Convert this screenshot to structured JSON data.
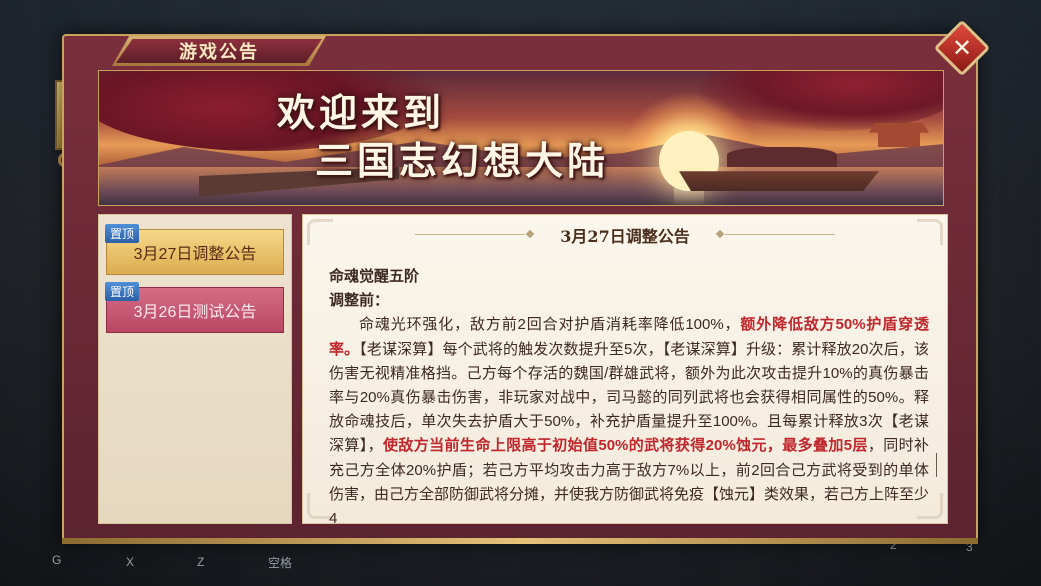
{
  "window": {
    "title": "游戏公告",
    "close_icon": "close-icon"
  },
  "banner": {
    "line1": "欢迎来到",
    "line2": "三国志幻想大陆"
  },
  "tabs": [
    {
      "pin_label": "置顶",
      "label": "3月27日调整公告",
      "active": true
    },
    {
      "pin_label": "置顶",
      "label": "3月26日测试公告",
      "active": false
    }
  ],
  "content": {
    "title": "3月27日调整公告",
    "heading": "命魂觉醒五阶",
    "subheading": "调整前：",
    "paragraph_segments": [
      {
        "text": "命魂光环强化，敌方前2回合对护盾消耗率降低100%，",
        "highlight": false
      },
      {
        "text": "额外降低敌方50%护盾穿透率。",
        "highlight": true
      },
      {
        "text": "【老谋深算】每个武将的触发次数提升至5次，【老谋深算】升级：累计释放20次后，该伤害无视精准格挡。己方每个存活的魏国/群雄武将，额外为此次攻击提升10%的真伤暴击率与20%真伤暴击伤害，非玩家对战中，司马懿的同列武将也会获得相同属性的50%。释放命魂技后，单次失去护盾大于50%，补充护盾量提升至100%。且每累计释放3次【老谋深算】，",
        "highlight": false
      },
      {
        "text": "使敌方当前生命上限高于初始值50%的武将获得20%蚀元，最多叠加5层",
        "highlight": true
      },
      {
        "text": "，同时补充己方全体20%护盾；若己方平均攻击力高于敌方7%以上，前2回合己方武将受到的单体伤害，由己方全部防御武将分摊，并使我方防御武将免疫【蚀元】类效果，若己方上阵至少4",
        "highlight": false
      }
    ]
  },
  "hotkeys": [
    "G",
    "X",
    "Z",
    "空格",
    "2",
    "3"
  ],
  "colors": {
    "frame": "#7a2f3c",
    "gold": "#c9a35d",
    "paper": "#f4ecdf",
    "highlight": "#c0262c",
    "active_tab": "#dcac4f",
    "inactive_tab": "#b94764",
    "pin": "#2c5fa6"
  }
}
